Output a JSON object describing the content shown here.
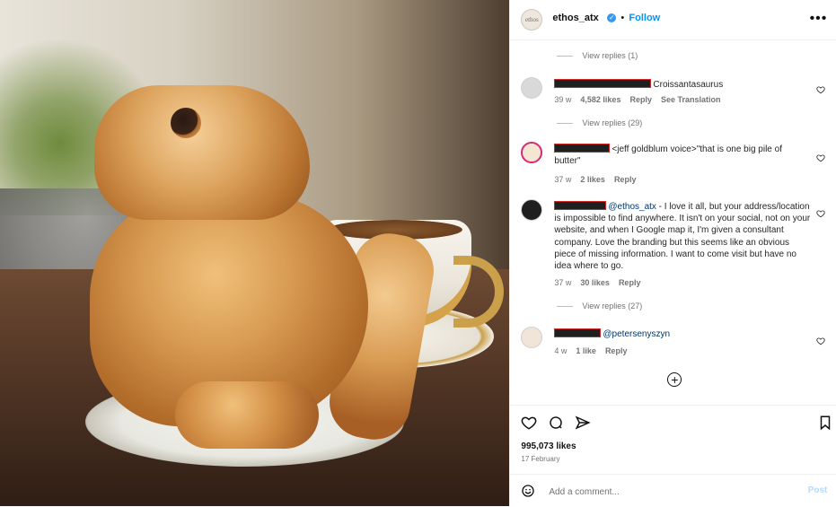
{
  "post": {
    "author": {
      "username": "ethos_atx",
      "verified": true,
      "avatar_text": "ethos",
      "follow_label": "Follow",
      "separator": "•"
    },
    "likes_text": "995,073 likes",
    "date_text": "17 February",
    "add_comment_placeholder": "Add a comment...",
    "post_label": "Post"
  },
  "comments": [
    {
      "view_replies_above": "View replies (1)"
    },
    {
      "text": "Croissantasaurus",
      "meta": {
        "age": "39 w",
        "likes": "4,582 likes",
        "reply": "Reply",
        "translate": "See Translation"
      },
      "view_replies_below": "View replies (29)"
    },
    {
      "text": "<jeff goldblum voice>\"that is one big pile of butter\"",
      "meta": {
        "age": "37 w",
        "likes": "2 likes",
        "reply": "Reply"
      }
    },
    {
      "mention": "@ethos_atx",
      "text": " - I love it all, but your address/location is impossible to find anywhere. It isn't on your social, not on your website, and when I Google map it, I'm given a consultant company. Love the branding but this seems like an obvious piece of missing information. I want to come visit but have no idea where to go.",
      "meta": {
        "age": "37 w",
        "likes": "30 likes",
        "reply": "Reply"
      },
      "view_replies_below": "View replies (27)"
    },
    {
      "mention": "@petersenyszyn",
      "meta": {
        "age": "4 w",
        "likes": "1 like",
        "reply": "Reply"
      }
    }
  ],
  "icons": {
    "more": "more-options-icon",
    "heart": "heart-icon",
    "comment": "comment-icon",
    "share": "share-icon",
    "bookmark": "bookmark-icon",
    "emoji": "emoji-icon",
    "load_more": "plus-circle-icon"
  },
  "colors": {
    "accent": "#0095f6",
    "verified": "#3897f0",
    "secondary_text": "#737373",
    "mention": "#00376b",
    "post_disabled": "#b3dbff"
  }
}
